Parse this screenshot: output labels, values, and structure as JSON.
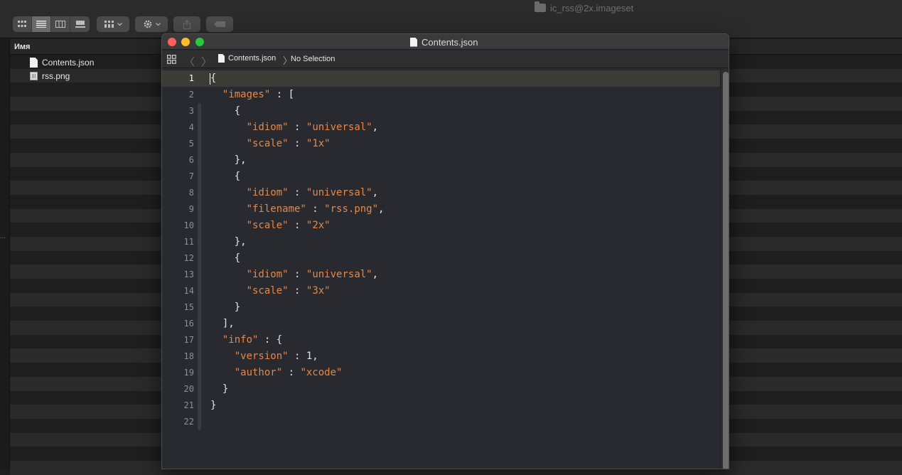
{
  "finder": {
    "window_title": "ic_rss@2x.imageset",
    "column_header": "Имя",
    "files": [
      {
        "name": "Contents.json",
        "icon": "document-icon"
      },
      {
        "name": "rss.png",
        "icon": "image-file-icon"
      }
    ],
    "left_marker": "..."
  },
  "toolbar": {
    "view_modes": [
      "icon-view-icon",
      "list-view-icon",
      "column-view-icon",
      "gallery-view-icon"
    ],
    "active_view": "list-view-icon",
    "group_button_icon": "group-grid-icon",
    "action_button_icon": "gear-icon",
    "share_button_icon": "share-icon",
    "tag_button_icon": "tag-icon"
  },
  "editor": {
    "title": "Contents.json",
    "jumpbar": {
      "file": "Contents.json",
      "separator": "〉",
      "selection": "No Selection",
      "back": "〈",
      "forward": "〉"
    },
    "current_line": 1,
    "line_numbers": [
      "1",
      "2",
      "3",
      "4",
      "5",
      "6",
      "7",
      "8",
      "9",
      "10",
      "11",
      "12",
      "13",
      "14",
      "15",
      "16",
      "17",
      "18",
      "19",
      "20",
      "21",
      "22"
    ],
    "lines": [
      {
        "indent": "",
        "text": "{"
      },
      {
        "indent": "  ",
        "key": "\"images\"",
        "rest": " : ["
      },
      {
        "indent": "    ",
        "text": "{"
      },
      {
        "indent": "      ",
        "key": "\"idiom\"",
        "sep": " : ",
        "val": "\"universal\"",
        "tail": ","
      },
      {
        "indent": "      ",
        "key": "\"scale\"",
        "sep": " : ",
        "val": "\"1x\"",
        "tail": ""
      },
      {
        "indent": "    ",
        "text": "},"
      },
      {
        "indent": "    ",
        "text": "{"
      },
      {
        "indent": "      ",
        "key": "\"idiom\"",
        "sep": " : ",
        "val": "\"universal\"",
        "tail": ","
      },
      {
        "indent": "      ",
        "key": "\"filename\"",
        "sep": " : ",
        "val": "\"rss.png\"",
        "tail": ","
      },
      {
        "indent": "      ",
        "key": "\"scale\"",
        "sep": " : ",
        "val": "\"2x\"",
        "tail": ""
      },
      {
        "indent": "    ",
        "text": "},"
      },
      {
        "indent": "    ",
        "text": "{"
      },
      {
        "indent": "      ",
        "key": "\"idiom\"",
        "sep": " : ",
        "val": "\"universal\"",
        "tail": ","
      },
      {
        "indent": "      ",
        "key": "\"scale\"",
        "sep": " : ",
        "val": "\"3x\"",
        "tail": ""
      },
      {
        "indent": "    ",
        "text": "}"
      },
      {
        "indent": "  ",
        "text": "],"
      },
      {
        "indent": "  ",
        "key": "\"info\"",
        "rest": " : {"
      },
      {
        "indent": "    ",
        "key": "\"version\"",
        "rest": " : 1,"
      },
      {
        "indent": "    ",
        "key": "\"author\"",
        "sep": " : ",
        "val": "\"xcode\"",
        "tail": ""
      },
      {
        "indent": "  ",
        "text": "}"
      },
      {
        "indent": "",
        "text": "}"
      },
      {
        "indent": "",
        "text": ""
      }
    ]
  },
  "colors": {
    "string": "#e5884a",
    "plain": "#e3e3e3",
    "editor_bg": "#292a30",
    "current_line": "#3b3c36",
    "close": "#fe5f57",
    "minimize": "#febc2e",
    "zoom": "#28c840"
  }
}
